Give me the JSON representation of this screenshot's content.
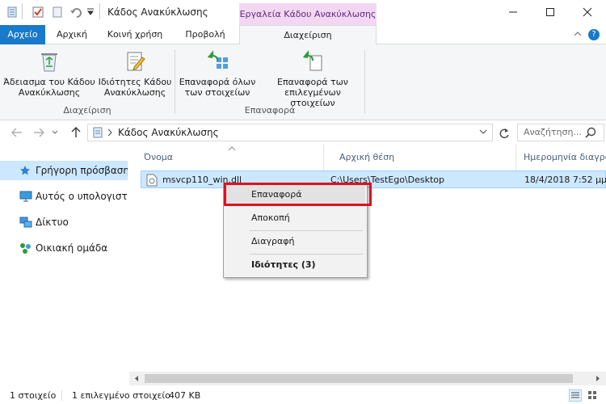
{
  "window": {
    "title": "Κάδος Ανακύκλωσης",
    "context_tab_title": "Εργαλεία Κάδου Ανακύκλωσης"
  },
  "ribbon_tabs": [
    "Αρχείο",
    "Αρχική",
    "Κοινή χρήση",
    "Προβολή",
    "Διαχείριση"
  ],
  "ribbon": {
    "buttons": [
      {
        "label": "Άδειασμα του Κάδου\nΑνακύκλωσης",
        "icon": "recycle-bin-icon"
      },
      {
        "label": "Ιδιότητες Κάδου\nΑνακύκλωσης",
        "icon": "properties-icon"
      },
      {
        "label": "Επαναφορά όλων\nτων στοιχείων",
        "icon": "restore-all-icon"
      },
      {
        "label": "Επαναφορά των\nεπιλεγμένων στοιχείων",
        "icon": "restore-selected-icon"
      }
    ],
    "groups": [
      "Διαχείριση",
      "Επαναφορά"
    ]
  },
  "address": {
    "path": "Κάδος Ανακύκλωσης",
    "search_placeholder": "Αναζήτηση..."
  },
  "nav": [
    {
      "label": "Γρήγορη πρόσβαση",
      "icon": "star-icon"
    },
    {
      "label": "Αυτός ο υπολογιστής",
      "icon": "computer-icon"
    },
    {
      "label": "Δίκτυο",
      "icon": "network-icon"
    },
    {
      "label": "Οικιακή ομάδα",
      "icon": "homegroup-icon"
    }
  ],
  "columns": [
    "Όνομα",
    "Αρχική θέση",
    "Ημερομηνία διαγρα"
  ],
  "file": {
    "name": "msvcp110_win.dll",
    "location": "C:\\Users\\TestEgo\\Desktop",
    "date": "18/4/2018 7:52 μμ"
  },
  "context_menu": [
    "Επαναφορά",
    "Αποκοπή",
    "Διαγραφή",
    "Ιδιότητες (3)"
  ],
  "status": {
    "count": "1 στοιχείο",
    "selected": "1 επιλεγμένο στοιχείο",
    "size": "407 KB"
  },
  "colors": {
    "accent": "#1979ca",
    "context_tab": "#f3d7f2",
    "selection": "#cce8ff",
    "highlight_box": "#e0101e"
  }
}
